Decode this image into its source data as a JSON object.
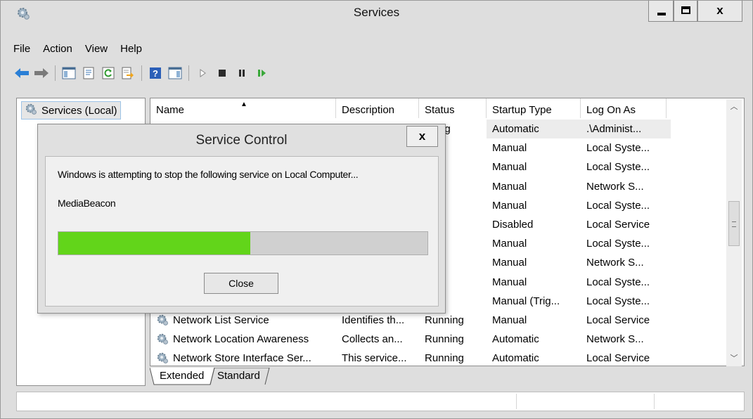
{
  "window": {
    "title": "Services",
    "controls": [
      "minimize",
      "maximize",
      "close"
    ]
  },
  "menu": [
    "File",
    "Action",
    "View",
    "Help"
  ],
  "toolbar": [
    "back-icon",
    "forward-icon",
    "show-hide-console-tree-icon",
    "properties-icon",
    "refresh-icon",
    "export-list-icon",
    "help-icon",
    "show-hide-action-pane-icon",
    "start-service-icon",
    "stop-service-icon",
    "pause-service-icon",
    "resume-service-icon"
  ],
  "tree": {
    "label": "Services (Local)"
  },
  "columns": [
    "Name",
    "Description",
    "Status",
    "Startup Type",
    "Log On As"
  ],
  "rows": [
    {
      "name": "",
      "description": "",
      "status": "nning",
      "startup": "Automatic",
      "logon": ".\\Administ..."
    },
    {
      "name": "",
      "description": "",
      "status": "",
      "startup": "Manual",
      "logon": "Local Syste..."
    },
    {
      "name": "",
      "description": "",
      "status": "",
      "startup": "Manual",
      "logon": "Local Syste..."
    },
    {
      "name": "",
      "description": "",
      "status": "",
      "startup": "Manual",
      "logon": "Network S..."
    },
    {
      "name": "",
      "description": "",
      "status": "",
      "startup": "Manual",
      "logon": "Local Syste..."
    },
    {
      "name": "",
      "description": "",
      "status": "",
      "startup": "Disabled",
      "logon": "Local Service"
    },
    {
      "name": "",
      "description": "",
      "status": "",
      "startup": "Manual",
      "logon": "Local Syste..."
    },
    {
      "name": "",
      "description": "",
      "status": "",
      "startup": "Manual",
      "logon": "Network S..."
    },
    {
      "name": "",
      "description": "",
      "status": "",
      "startup": "Manual",
      "logon": "Local Syste..."
    },
    {
      "name": "",
      "description": "",
      "status": "",
      "startup": "Manual (Trig...",
      "logon": "Local Syste..."
    },
    {
      "name": "Network List Service",
      "description": "Identifies th...",
      "status": "Running",
      "startup": "Manual",
      "logon": "Local Service"
    },
    {
      "name": "Network Location Awareness",
      "description": "Collects an...",
      "status": "Running",
      "startup": "Automatic",
      "logon": "Network S..."
    },
    {
      "name": "Network Store Interface Ser...",
      "description": "This service...",
      "status": "Running",
      "startup": "Automatic",
      "logon": "Local Service"
    }
  ],
  "tabs": [
    "Extended",
    "Standard"
  ],
  "dialog": {
    "title": "Service Control",
    "message": "Windows is attempting to stop the following service on Local Computer...",
    "service": "MediaBeacon",
    "progress": 0.52,
    "button": "Close"
  }
}
